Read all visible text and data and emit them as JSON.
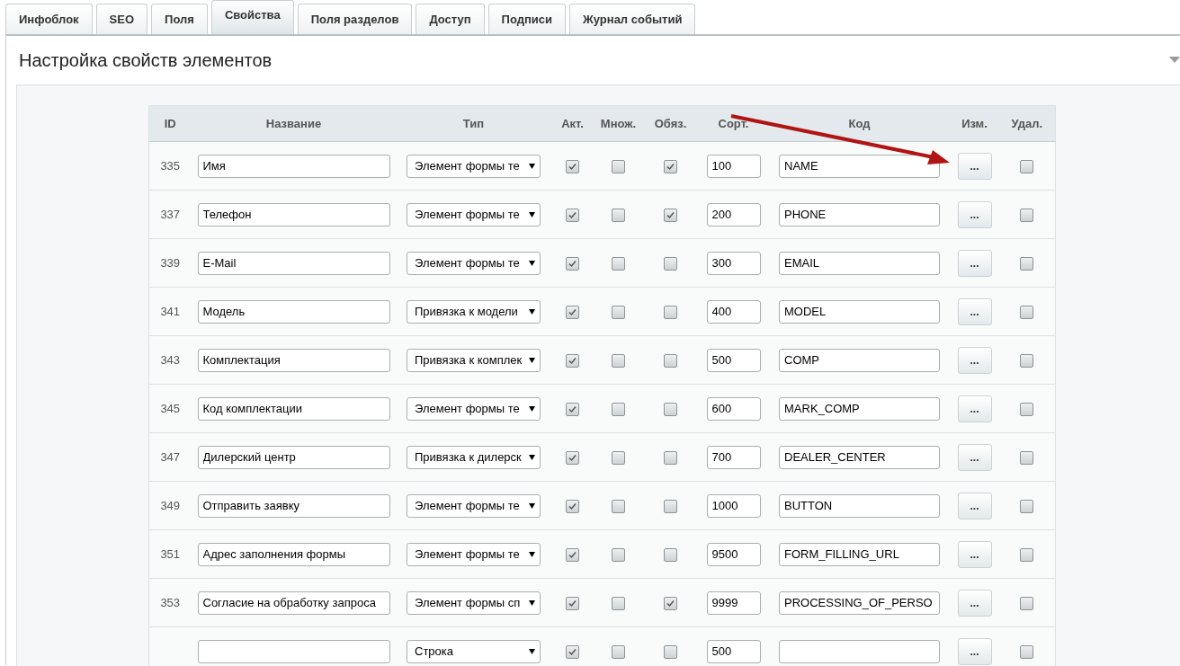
{
  "tabs": [
    {
      "label": "Инфоблок",
      "selected": false
    },
    {
      "label": "SEO",
      "selected": false
    },
    {
      "label": "Поля",
      "selected": false
    },
    {
      "label": "Свойства",
      "selected": true
    },
    {
      "label": "Поля разделов",
      "selected": false
    },
    {
      "label": "Доступ",
      "selected": false
    },
    {
      "label": "Подписи",
      "selected": false
    },
    {
      "label": "Журнал событий",
      "selected": false
    }
  ],
  "panel": {
    "title": "Настройка свойств элементов"
  },
  "table": {
    "columns": [
      "ID",
      "Название",
      "Тип",
      "Акт.",
      "Множ.",
      "Обяз.",
      "Сорт.",
      "Код",
      "Изм.",
      "Удал."
    ],
    "rows": [
      {
        "id": "335",
        "name": "Имя",
        "type": "Элемент формы те",
        "active": true,
        "multiple": false,
        "required": true,
        "sort": "100",
        "code": "NAME",
        "edit": "...",
        "delete": false
      },
      {
        "id": "337",
        "name": "Телефон",
        "type": "Элемент формы те",
        "active": true,
        "multiple": false,
        "required": true,
        "sort": "200",
        "code": "PHONE",
        "edit": "...",
        "delete": false
      },
      {
        "id": "339",
        "name": "E-Mail",
        "type": "Элемент формы те",
        "active": true,
        "multiple": false,
        "required": false,
        "sort": "300",
        "code": "EMAIL",
        "edit": "...",
        "delete": false
      },
      {
        "id": "341",
        "name": "Модель",
        "type": "Привязка к модели",
        "active": true,
        "multiple": false,
        "required": false,
        "sort": "400",
        "code": "MODEL",
        "edit": "...",
        "delete": false
      },
      {
        "id": "343",
        "name": "Комплектация",
        "type": "Привязка к комплек",
        "active": true,
        "multiple": false,
        "required": false,
        "sort": "500",
        "code": "COMP",
        "edit": "...",
        "delete": false
      },
      {
        "id": "345",
        "name": "Код комплектации",
        "type": "Элемент формы те",
        "active": true,
        "multiple": false,
        "required": false,
        "sort": "600",
        "code": "MARK_COMP",
        "edit": "...",
        "delete": false
      },
      {
        "id": "347",
        "name": "Дилерский центр",
        "type": "Привязка к дилерск",
        "active": true,
        "multiple": false,
        "required": false,
        "sort": "700",
        "code": "DEALER_CENTER",
        "edit": "...",
        "delete": false
      },
      {
        "id": "349",
        "name": "Отправить заявку",
        "type": "Элемент формы те",
        "active": true,
        "multiple": false,
        "required": false,
        "sort": "1000",
        "code": "BUTTON",
        "edit": "...",
        "delete": false
      },
      {
        "id": "351",
        "name": "Адрес заполнения формы",
        "type": "Элемент формы те",
        "active": true,
        "multiple": false,
        "required": false,
        "sort": "9500",
        "code": "FORM_FILLING_URL",
        "edit": "...",
        "delete": false
      },
      {
        "id": "353",
        "name": "Согласие на обработку запроса",
        "type": "Элемент формы сп",
        "active": true,
        "multiple": false,
        "required": true,
        "sort": "9999",
        "code": "PROCESSING_OF_PERSO",
        "edit": "...",
        "delete": false
      },
      {
        "type": "Строка",
        "active": true,
        "multiple": false,
        "required": false,
        "sort": "500",
        "edit": "...",
        "delete": false
      }
    ]
  }
}
